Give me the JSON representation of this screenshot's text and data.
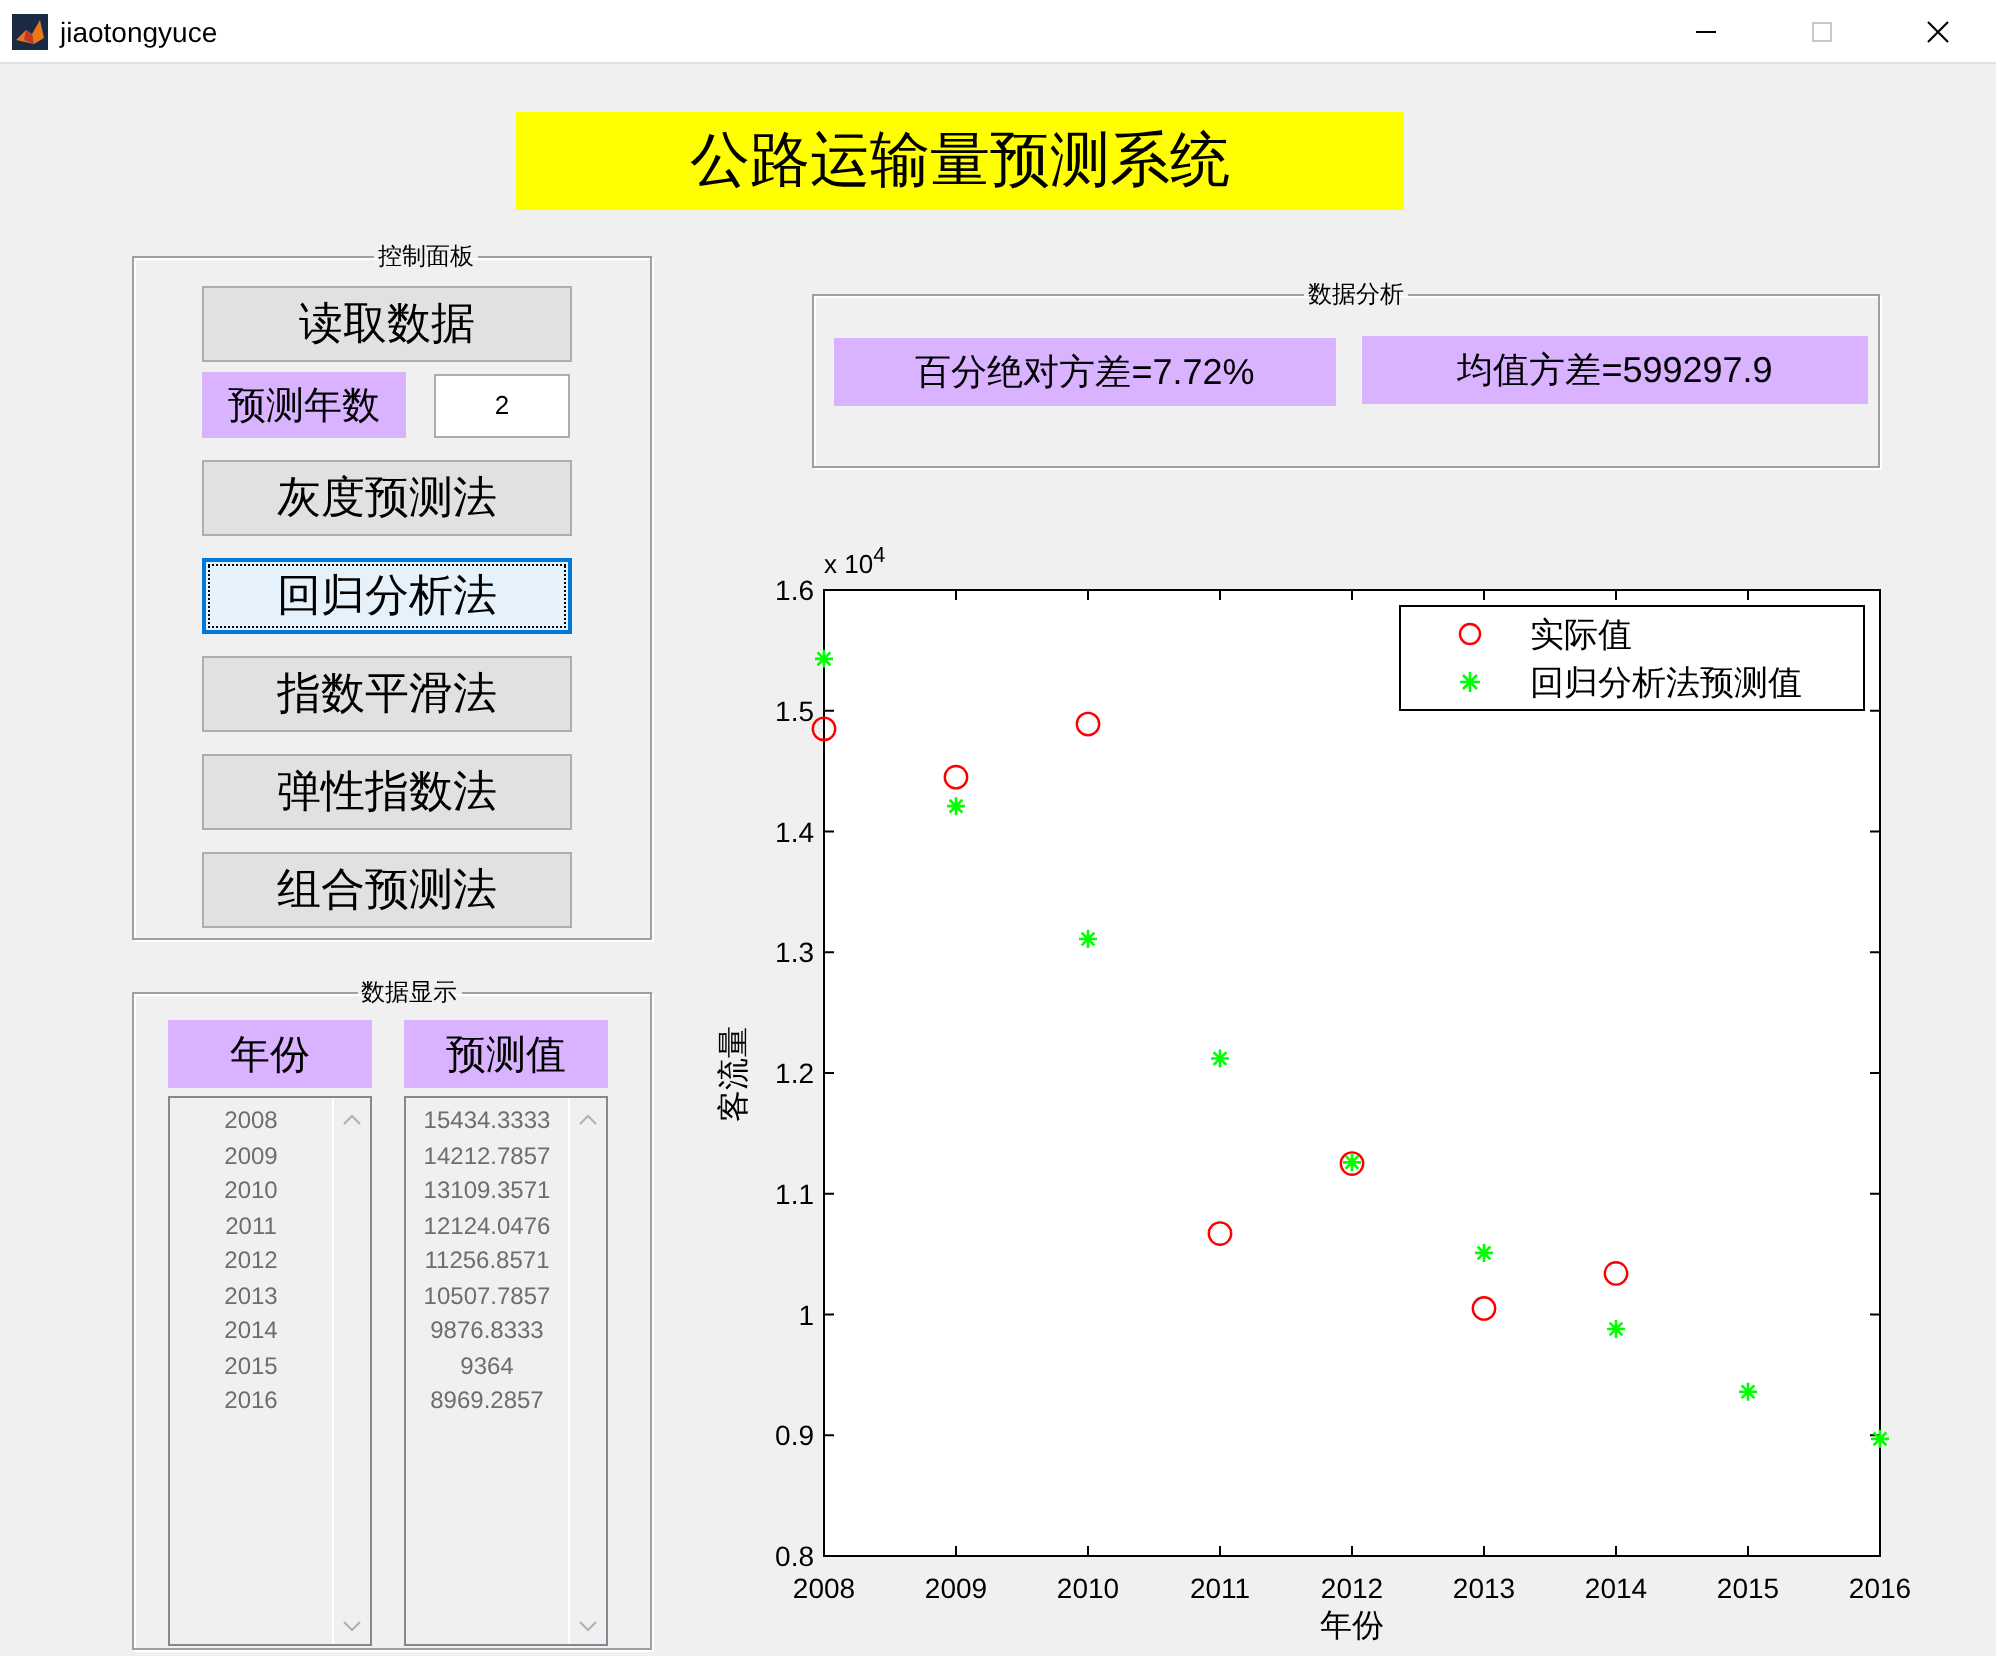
{
  "window": {
    "title": "jiaotongyuce",
    "controls": [
      {
        "kind": "minimize",
        "disabled": false
      },
      {
        "kind": "maximize",
        "disabled": true
      },
      {
        "kind": "close",
        "disabled": false
      }
    ]
  },
  "banner": {
    "title": "公路运输量预测系统"
  },
  "control_panel": {
    "title": "控制面板",
    "read_button": {
      "label": "读取数据",
      "focused": false
    },
    "forecast_years": {
      "label": "预测年数",
      "value": "2"
    },
    "method_buttons": [
      {
        "label": "灰度预测法",
        "focused": false
      },
      {
        "label": "回归分析法",
        "focused": true
      },
      {
        "label": "指数平滑法",
        "focused": false
      },
      {
        "label": "弹性指数法",
        "focused": false
      },
      {
        "label": "组合预测法",
        "focused": false
      }
    ]
  },
  "data_display": {
    "title": "数据显示",
    "columns": [
      {
        "header": "年份",
        "rows": [
          "2008",
          "2009",
          "2010",
          "2011",
          "2012",
          "2013",
          "2014",
          "2015",
          "2016"
        ]
      },
      {
        "header": "预测值",
        "rows": [
          "15434.3333",
          "14212.7857",
          "13109.3571",
          "12124.0476",
          "11256.8571",
          "10507.7857",
          "9876.8333",
          "9364",
          "8969.2857"
        ]
      }
    ]
  },
  "analysis": {
    "title": "数据分析",
    "results": [
      "百分绝对方差=7.72%",
      "均值方差=599297.9"
    ]
  },
  "chart": {
    "multiplier": "x 10$^{4}$",
    "chart_data": {
      "type": "scatter",
      "xlabel": "年份",
      "ylabel": "客流量",
      "x": [
        2008,
        2009,
        2010,
        2011,
        2012,
        2013,
        2014,
        2015,
        2016
      ],
      "series": [
        {
          "name": "实际值",
          "color": "#ff0000",
          "marker": "circle",
          "values": [
            1.485,
            1.445,
            1.489,
            1.067,
            1.125,
            1.005,
            1.034,
            null,
            null
          ]
        },
        {
          "name": "回归分析法预测值",
          "color": "#00ff00",
          "marker": "cross",
          "values": [
            1.543,
            1.421,
            1.311,
            1.212,
            1.126,
            1.051,
            0.988,
            0.936,
            0.897
          ]
        }
      ],
      "legend": "upper right",
      "xlim": [
        2008,
        2016
      ],
      "ylim": [
        0.8,
        1.6
      ],
      "xticks": [
        2008,
        2009,
        2010,
        2011,
        2012,
        2013,
        2014,
        2015,
        2016
      ],
      "yticks": [
        0.8,
        0.9,
        1,
        1.1,
        1.2,
        1.3,
        1.4,
        1.5,
        1.6
      ]
    }
  }
}
